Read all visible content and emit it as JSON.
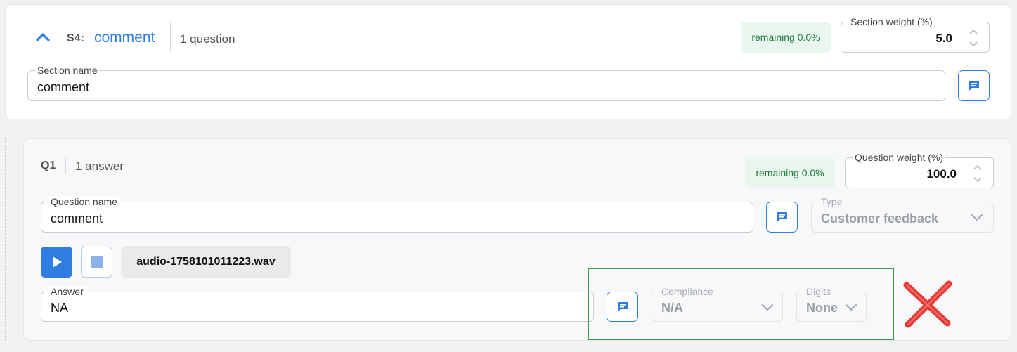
{
  "section": {
    "code": "S4:",
    "title": "comment",
    "question_count": "1 question",
    "remaining": "remaining 0.0%",
    "weight_label": "Section weight (%)",
    "weight_value": "5.0",
    "name_label": "Section name",
    "name_value": "comment"
  },
  "question": {
    "code": "Q1",
    "answer_count": "1 answer",
    "remaining": "remaining 0.0%",
    "weight_label": "Question weight (%)",
    "weight_value": "100.0",
    "name_label": "Question name",
    "name_value": "comment",
    "type_label": "Type",
    "type_value": "Customer feedback",
    "audio_file": "audio-1758101011223.wav"
  },
  "answer": {
    "label": "Answer",
    "value": "NA",
    "compliance_label": "Compliance",
    "compliance_value": "N/A",
    "digits_label": "Digits",
    "digits_value": "None"
  },
  "colors": {
    "accent": "#2f7de1",
    "remaining_bg": "#e9f7ef",
    "remaining_text": "#1e7d3a",
    "highlight_border": "#3d9a3d",
    "red_x": "#e53935"
  }
}
